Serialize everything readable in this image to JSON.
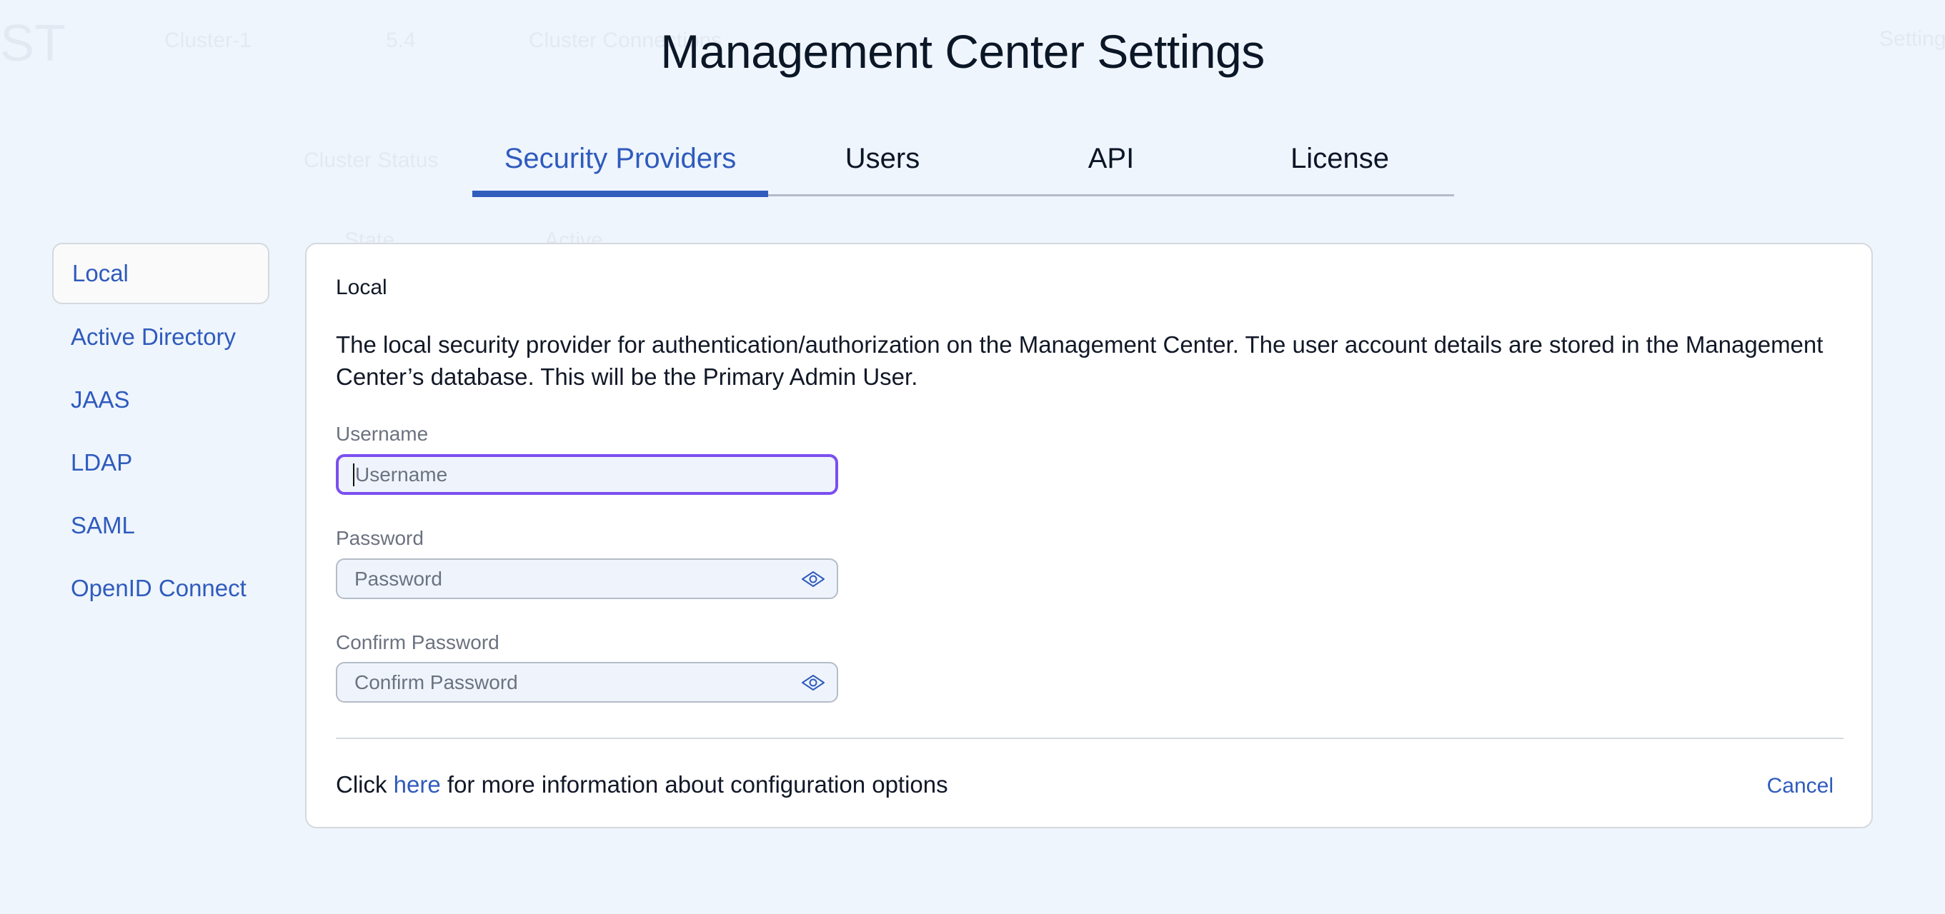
{
  "background": {
    "logo": "ST",
    "cluster": "Cluster-1",
    "version": "5.4",
    "connections": "Cluster Connections",
    "status": "Cluster Status",
    "state": "State",
    "active": "Active",
    "settings": "Settings"
  },
  "modal": {
    "title": "Management Center Settings",
    "tabs": [
      {
        "label": "Security Providers",
        "active": true
      },
      {
        "label": "Users"
      },
      {
        "label": "API"
      },
      {
        "label": "License"
      }
    ],
    "providers": [
      {
        "label": "Local",
        "active": true
      },
      {
        "label": "Active Directory"
      },
      {
        "label": "JAAS"
      },
      {
        "label": "LDAP"
      },
      {
        "label": "SAML"
      },
      {
        "label": "OpenID Connect"
      }
    ],
    "panel": {
      "heading": "Local",
      "description": "The local security provider for authentication/authorization on the Management Center. The user account details are stored in the Management Center’s database. This will be the Primary Admin User.",
      "username": {
        "label": "Username",
        "value": "",
        "placeholder": "Username"
      },
      "password": {
        "label": "Password",
        "value": "",
        "placeholder": "Password"
      },
      "confirm": {
        "label": "Confirm Password",
        "value": "",
        "placeholder": "Confirm Password"
      },
      "footer": {
        "prefix": "Click ",
        "link": "here",
        "suffix": " for more information about configuration options"
      },
      "cancel_label": "Cancel"
    }
  },
  "colors": {
    "accent": "#2f5bbd",
    "focus": "#7b4ff0",
    "background": "#eff5fd"
  }
}
